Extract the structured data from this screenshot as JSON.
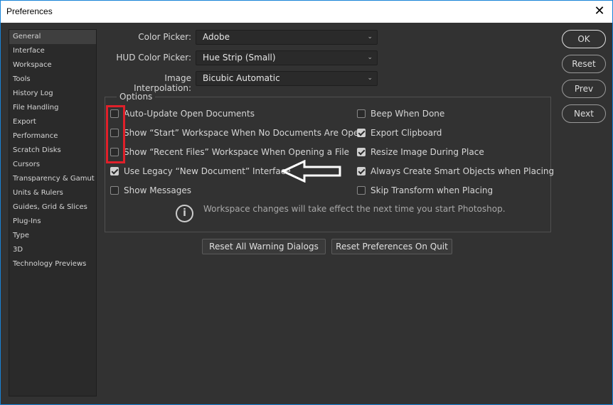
{
  "window": {
    "title": "Preferences",
    "close_icon": "close-icon"
  },
  "sidebar": {
    "items": [
      {
        "label": "General",
        "active": true
      },
      {
        "label": "Interface"
      },
      {
        "label": "Workspace"
      },
      {
        "label": "Tools"
      },
      {
        "label": "History Log"
      },
      {
        "label": "File Handling"
      },
      {
        "label": "Export"
      },
      {
        "label": "Performance"
      },
      {
        "label": "Scratch Disks"
      },
      {
        "label": "Cursors"
      },
      {
        "label": "Transparency & Gamut"
      },
      {
        "label": "Units & Rulers"
      },
      {
        "label": "Guides, Grid & Slices"
      },
      {
        "label": "Plug-Ins"
      },
      {
        "label": "Type"
      },
      {
        "label": "3D"
      },
      {
        "label": "Technology Previews"
      }
    ]
  },
  "fields": [
    {
      "label": "Color Picker:",
      "value": "Adobe"
    },
    {
      "label": "HUD Color Picker:",
      "value": "Hue Strip (Small)"
    },
    {
      "label": "Image Interpolation:",
      "value": "Bicubic Automatic"
    }
  ],
  "options": {
    "title": "Options",
    "left": [
      {
        "label": "Auto-Update Open Documents",
        "checked": false
      },
      {
        "label": "Show “Start” Workspace When No Documents Are Open",
        "checked": false
      },
      {
        "label": "Show “Recent Files” Workspace When Opening a File",
        "checked": false
      },
      {
        "label": "Use Legacy “New Document” Interface",
        "checked": true
      },
      {
        "label": "Show Messages",
        "checked": false
      }
    ],
    "right": [
      {
        "label": "Beep When Done",
        "checked": false
      },
      {
        "label": "Export Clipboard",
        "checked": true
      },
      {
        "label": "Resize Image During Place",
        "checked": true
      },
      {
        "label": "Always Create Smart Objects when Placing",
        "checked": true
      },
      {
        "label": "Skip Transform when Placing",
        "checked": false
      }
    ],
    "info": "Workspace changes will take effect the next time you start Photoshop."
  },
  "buttons": {
    "reset_warnings": "Reset All Warning Dialogs",
    "reset_prefs": "Reset Preferences On Quit",
    "ok": "OK",
    "reset": "Reset",
    "prev": "Prev",
    "next": "Next"
  },
  "annotation_colors": {
    "highlight": "#e0202a",
    "arrow": "#ffffff"
  }
}
